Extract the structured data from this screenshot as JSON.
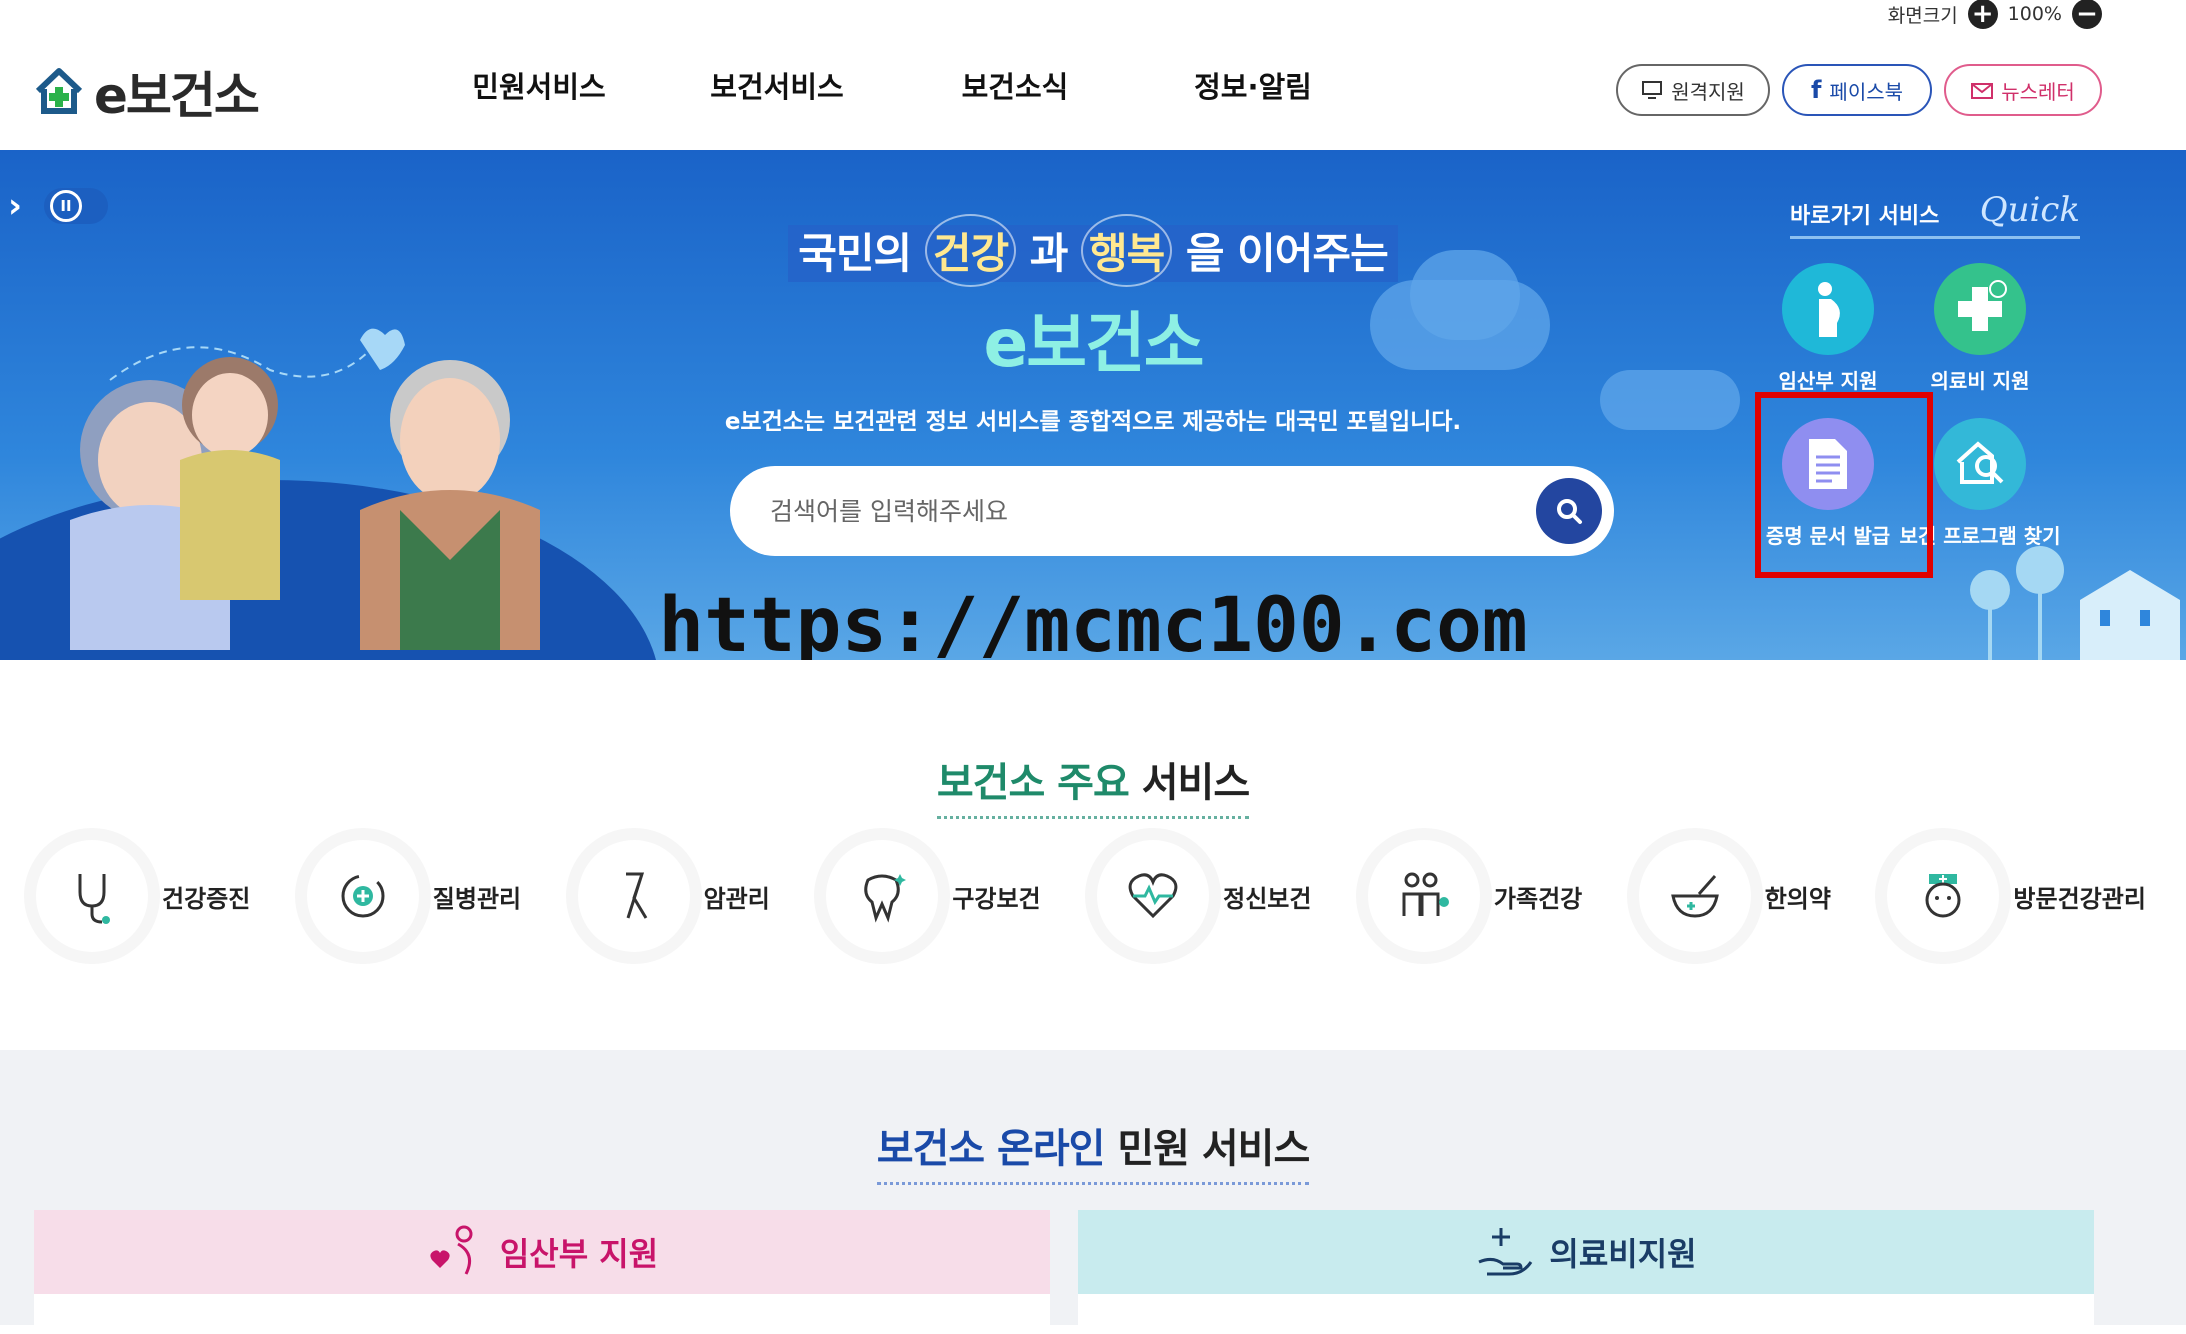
{
  "util": {
    "screen_size_label": "화면크기",
    "zoom": "100%",
    "zoom_in": "+",
    "zoom_out": "−"
  },
  "logo": {
    "text": "e보건소"
  },
  "gnb": [
    "민원서비스",
    "보건서비스",
    "보건소식",
    "정보·알림"
  ],
  "header_buttons": {
    "remote": "원격지원",
    "facebook": "페이스북",
    "newsletter": "뉴스레터"
  },
  "hero": {
    "title_prefix": "국민의",
    "title_word1": "건강",
    "title_mid": "과",
    "title_word2": "행복",
    "title_suffix": "을 이어주는",
    "brand": "e보건소",
    "description": "e보건소는 보건관련 정보 서비스를 종합적으로 제공하는 대국민 포털입니다.",
    "search_placeholder": "검색어를 입력해주세요",
    "watermark": "https://mcmc100.com"
  },
  "quick": {
    "title": "바로가기 서비스",
    "title_en": "Quick",
    "items": [
      {
        "label": "임산부 지원",
        "color": "#1fb8d8",
        "icon": "pregnant-icon"
      },
      {
        "label": "의료비 지원",
        "color": "#34c28c",
        "icon": "medical-cross-icon"
      },
      {
        "label": "증명 문서 발급",
        "color": "#8f8ef0",
        "icon": "document-icon"
      },
      {
        "label": "보건 프로그램 찾기",
        "color": "#33b8d8",
        "icon": "home-search-icon"
      }
    ]
  },
  "main_services": {
    "title_a": "보건소 주요",
    "title_b": "서비스",
    "items": [
      "건강증진",
      "질병관리",
      "암관리",
      "구강보건",
      "정신보건",
      "가족건강",
      "한의약",
      "방문건강관리"
    ]
  },
  "online": {
    "title_a": "보건소 온라인",
    "title_b": "민원 서비스",
    "panels": [
      {
        "label": "임산부 지원",
        "bg": "#f7dde9",
        "color": "#c8146a"
      },
      {
        "label": "의료비지원",
        "bg": "#c8ebee",
        "color": "#1a3c66"
      }
    ]
  }
}
